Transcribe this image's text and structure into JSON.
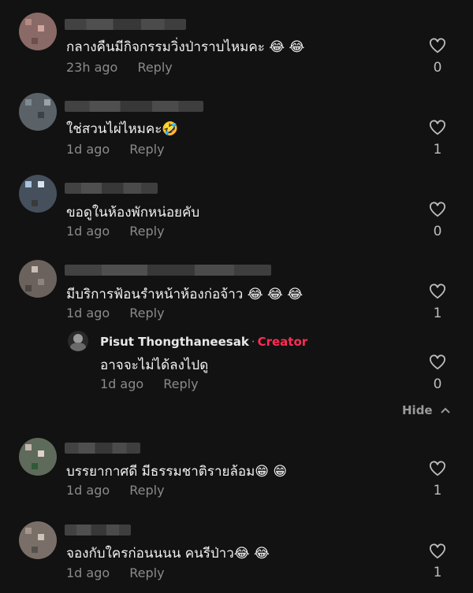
{
  "comments": [
    {
      "text": "กลางคืนมีกิจกรรมวิ่งป่าราบไหมคะ 😂 😂",
      "time": "23h ago",
      "reply": "Reply",
      "likes": "0"
    },
    {
      "text": "ใช่สวนไผ่ไหมคะ🤣",
      "time": "1d ago",
      "reply": "Reply",
      "likes": "1"
    },
    {
      "text": "ขอดูในห้องพักหน่อยคับ",
      "time": "1d ago",
      "reply": "Reply",
      "likes": "0"
    },
    {
      "text": "มีบริการฟ้อนรำหน้าห้องก่อจ้าว 😂 😂 😂",
      "time": "1d ago",
      "reply": "Reply",
      "likes": "1"
    },
    {
      "text": "บรรยากาศดี มีธรรมชาติรายล้อม😁 😁",
      "time": "1d ago",
      "reply": "Reply",
      "likes": "1"
    },
    {
      "text": "จองกับใครก่อนนนน คนรีป่าว😂 😂",
      "time": "1d ago",
      "reply": "Reply",
      "likes": "1"
    }
  ],
  "creator_reply": {
    "author": "Pisut Thongthaneesak",
    "separator": "·",
    "badge": "Creator",
    "text": "อาจจะไม่ได้ลงไปดู",
    "time": "1d ago",
    "reply": "Reply",
    "likes": "0"
  },
  "hide_label": "Hide",
  "icons": {
    "like": "heart-outline-icon",
    "collapse": "chevron-up-icon"
  },
  "colors": {
    "background": "#121212",
    "creator_badge": "#fe2c55",
    "muted": "#8a8a8a"
  }
}
